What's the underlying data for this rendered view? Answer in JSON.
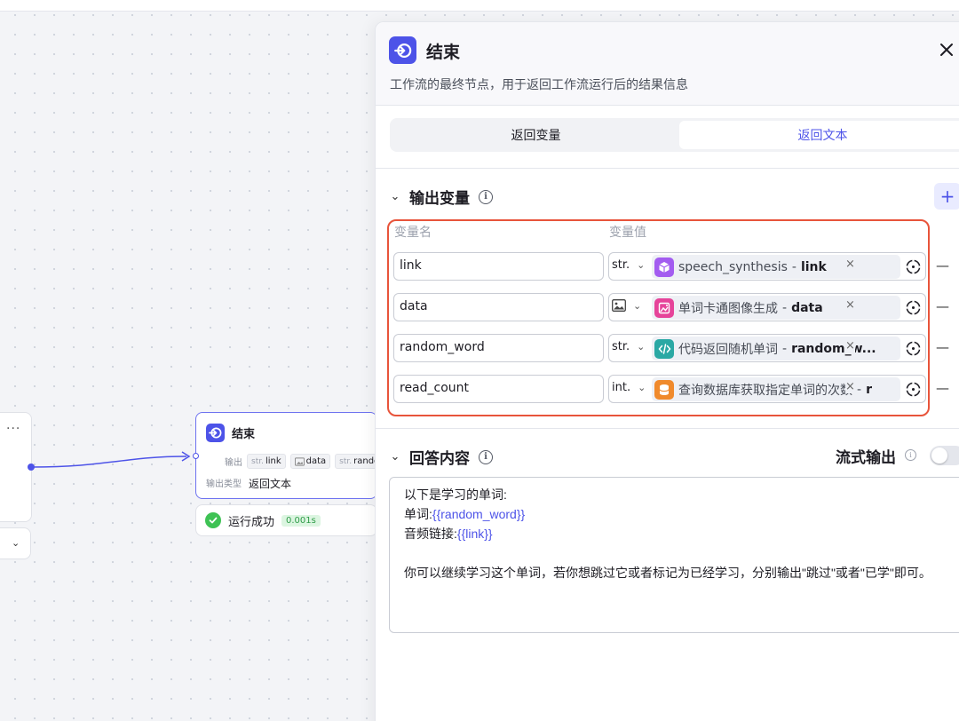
{
  "canvas": {
    "prev_node": {
      "more_label": "···"
    },
    "end_node": {
      "title": "结束",
      "output_label": "输出",
      "chips": [
        {
          "prefix": "str.",
          "name": "link"
        },
        {
          "prefix": "",
          "name": "data",
          "icon": "image-icon"
        },
        {
          "prefix": "str.",
          "name": "random_word"
        }
      ],
      "type_label": "输出类型",
      "type_value": "返回文本"
    },
    "run_status": {
      "label": "运行成功",
      "duration": "0.001s"
    }
  },
  "panel": {
    "title": "结束",
    "description": "工作流的最终节点，用于返回工作流运行后的结果信息",
    "tabs": [
      {
        "label": "返回变量",
        "active": false
      },
      {
        "label": "返回文本",
        "active": true
      }
    ],
    "output_section": {
      "title": "输出变量",
      "col_name": "变量名",
      "col_value": "变量值",
      "rows": [
        {
          "name": "link",
          "type": "str.",
          "source": "speech_synthesis",
          "variable": "link",
          "icon": "cube-icon",
          "icon_color": "#a35cf0"
        },
        {
          "name": "data",
          "type": "image",
          "source": "单词卡通图像生成",
          "variable": "data",
          "icon": "image-gen-icon",
          "icon_color": "#e6449a"
        },
        {
          "name": "random_word",
          "type": "str.",
          "source": "代码返回随机单词",
          "variable": "random_w...",
          "icon": "code-icon",
          "icon_color": "#2aa8a4"
        },
        {
          "name": "read_count",
          "type": "int.",
          "source": "查询数据库获取指定单词的次数",
          "variable": "r",
          "icon": "database-icon",
          "icon_color": "#f08a2c"
        }
      ]
    },
    "answer_section": {
      "title": "回答内容",
      "stream_label": "流式输出",
      "stream_enabled": false,
      "content": {
        "line1": "以下是学习的单词:",
        "line2_prefix": "单词:",
        "line2_var": "{{random_word}}",
        "line3_prefix": "音频链接:",
        "line3_var": "{{link}}",
        "paragraph": "你可以继续学习这个单词，若你想跳过它或者标记为已经学习，分别输出\"跳过\"或者\"已学\"即可。"
      }
    }
  },
  "colors": {
    "accent": "#4d53e8",
    "highlight_border": "#e8543b",
    "success": "#3ec254"
  }
}
